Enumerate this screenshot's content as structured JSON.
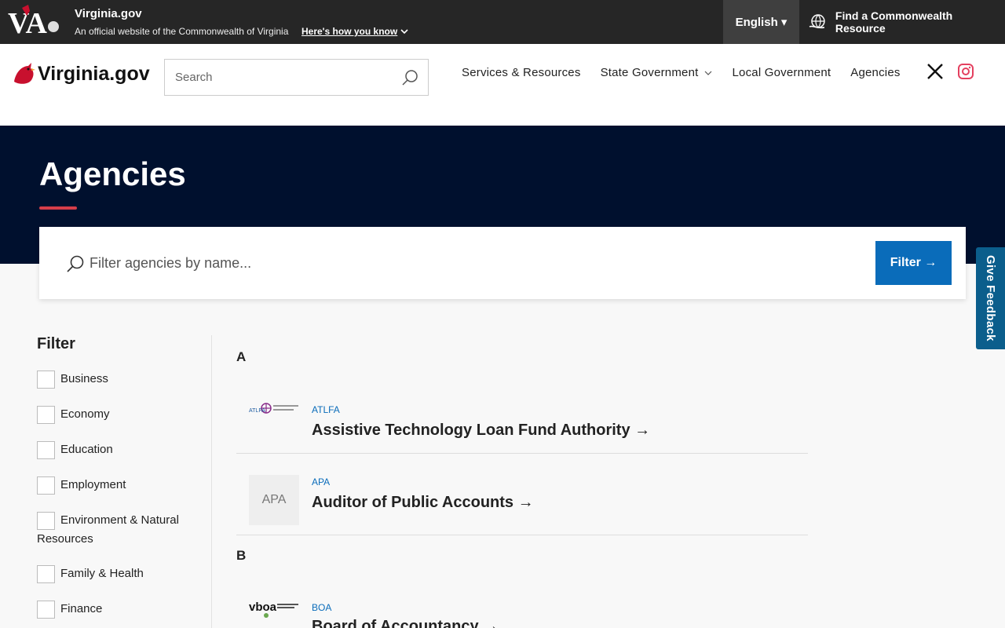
{
  "banner": {
    "title": "Virginia.gov",
    "subtitle": "An official website of the Commonwealth of Virginia",
    "link": "Here's how you know",
    "language": "English ▾",
    "resource": "Find a Commonwealth Resource",
    "logo_text": "VA"
  },
  "header": {
    "brand": "Virginia.gov",
    "search_placeholder": "Search",
    "nav": [
      {
        "label": "Services & Resources"
      },
      {
        "label": "State Government"
      },
      {
        "label": "Local Government"
      },
      {
        "label": "Agencies"
      }
    ]
  },
  "hero": {
    "title": "Agencies"
  },
  "filter": {
    "placeholder": "Filter agencies by name...",
    "button": "Filter →"
  },
  "sidebar": {
    "title": "Filter",
    "options": [
      {
        "label": "Business"
      },
      {
        "label": "Economy"
      },
      {
        "label": "Education"
      },
      {
        "label": "Employment"
      },
      {
        "label": "Environment & Natural Resources"
      },
      {
        "label": "Family & Health"
      },
      {
        "label": "Finance"
      }
    ]
  },
  "agencies": {
    "groups": [
      {
        "letter": "A"
      },
      {
        "letter": "B"
      }
    ],
    "items": [
      {
        "abbr": "ATLFA",
        "name": "Assistive Technology Loan Fund Authority →",
        "logo": "ATLFA"
      },
      {
        "abbr": "APA",
        "name": "Auditor of Public Accounts →",
        "logo": "APA"
      },
      {
        "abbr": "BOA",
        "name": "Board of Accountancy →",
        "logo": "vboa"
      }
    ]
  },
  "feedback": {
    "label": "Give Feedback"
  },
  "colors": {
    "banner_bg": "#262626",
    "hero_bg": "#00102e",
    "accent_red": "#d63e4a",
    "primary_blue": "#0a6cba",
    "feedback_bg": "#0b5e8c"
  }
}
